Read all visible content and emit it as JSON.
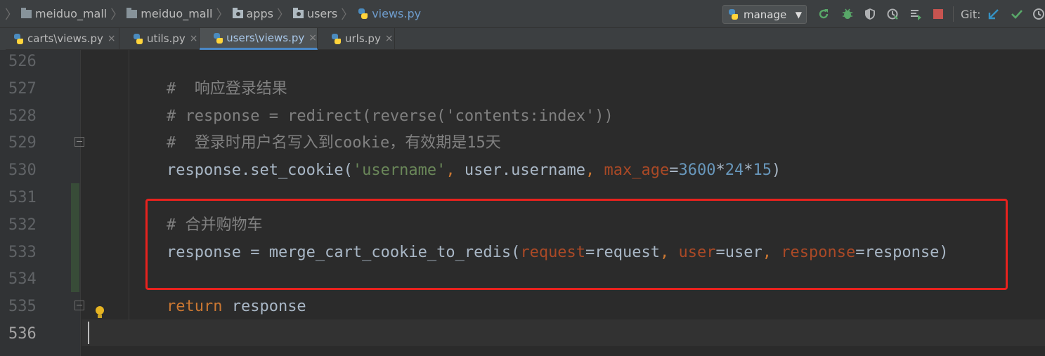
{
  "breadcrumbs": [
    {
      "label": "meiduo_mall",
      "icon": "folder-icon"
    },
    {
      "label": "meiduo_mall",
      "icon": "folder-icon"
    },
    {
      "label": "apps",
      "icon": "package-folder-icon"
    },
    {
      "label": "users",
      "icon": "package-folder-icon"
    },
    {
      "label": "views.py",
      "icon": "python-file-icon"
    }
  ],
  "run_config": {
    "label": "manage",
    "icon": "python-icon"
  },
  "toolbar": {
    "rerun_icon": "rerun-icon",
    "debug_icon": "debug-bug-icon",
    "coverage_icon": "coverage-shield-icon",
    "profile_icon": "profile-icon",
    "concurrency_icon": "concurrency-icon",
    "stop_icon": "stop-icon",
    "git_label": "Git:",
    "git_update_icon": "git-update-arrow-icon",
    "git_commit_icon": "git-commit-check-icon",
    "history_icon": "history-clock-icon"
  },
  "tabs": [
    {
      "label": "carts\\views.py",
      "active": false
    },
    {
      "label": "utils.py",
      "active": false
    },
    {
      "label": "users\\views.py",
      "active": true
    },
    {
      "label": "urls.py",
      "active": false
    }
  ],
  "tab_close_glyph": "×",
  "editor": {
    "lines": [
      {
        "num": "526",
        "tokens": []
      },
      {
        "num": "527",
        "tokens": [
          {
            "t": "#  响应登录结果",
            "c": "cm"
          }
        ]
      },
      {
        "num": "528",
        "tokens": [
          {
            "t": "# response = redirect(reverse('contents:index'))",
            "c": "cm"
          }
        ]
      },
      {
        "num": "529",
        "tokens": [
          {
            "t": "#  登录时用户名写入到cookie，有效期是15天",
            "c": "cm"
          }
        ]
      },
      {
        "num": "530",
        "tokens": [
          {
            "t": "response.set_cookie(",
            "c": ""
          },
          {
            "t": "'username'",
            "c": "str"
          },
          {
            "t": ", ",
            "c": "kw"
          },
          {
            "t": "user.username",
            "c": ""
          },
          {
            "t": ", ",
            "c": "kw"
          },
          {
            "t": "max_age",
            "c": "param"
          },
          {
            "t": "=",
            "c": ""
          },
          {
            "t": "3600",
            "c": "num"
          },
          {
            "t": "*",
            "c": ""
          },
          {
            "t": "24",
            "c": "num"
          },
          {
            "t": "*",
            "c": ""
          },
          {
            "t": "15",
            "c": "num"
          },
          {
            "t": ")",
            "c": ""
          }
        ]
      },
      {
        "num": "531",
        "tokens": []
      },
      {
        "num": "532",
        "tokens": [
          {
            "t": "# 合并购物车",
            "c": "cm"
          }
        ]
      },
      {
        "num": "533",
        "tokens": [
          {
            "t": "response = merge_cart_cookie_to_redis(",
            "c": ""
          },
          {
            "t": "request",
            "c": "param"
          },
          {
            "t": "=request",
            "c": ""
          },
          {
            "t": ", ",
            "c": "kw"
          },
          {
            "t": "user",
            "c": "param"
          },
          {
            "t": "=user",
            "c": ""
          },
          {
            "t": ", ",
            "c": "kw"
          },
          {
            "t": "response",
            "c": "param"
          },
          {
            "t": "=response)",
            "c": ""
          }
        ]
      },
      {
        "num": "534",
        "tokens": []
      },
      {
        "num": "535",
        "tokens": [
          {
            "t": "return ",
            "c": "kw"
          },
          {
            "t": "response",
            "c": ""
          }
        ]
      },
      {
        "num": "536",
        "tokens": [],
        "current": true
      }
    ]
  },
  "colors": {
    "comment": "#808080",
    "string": "#6a8759",
    "keyword": "#cc7832",
    "number": "#6897bb",
    "param": "#aa4926",
    "highlight_box": "#e8221e",
    "active_tab_underline": "#4a88c7"
  }
}
